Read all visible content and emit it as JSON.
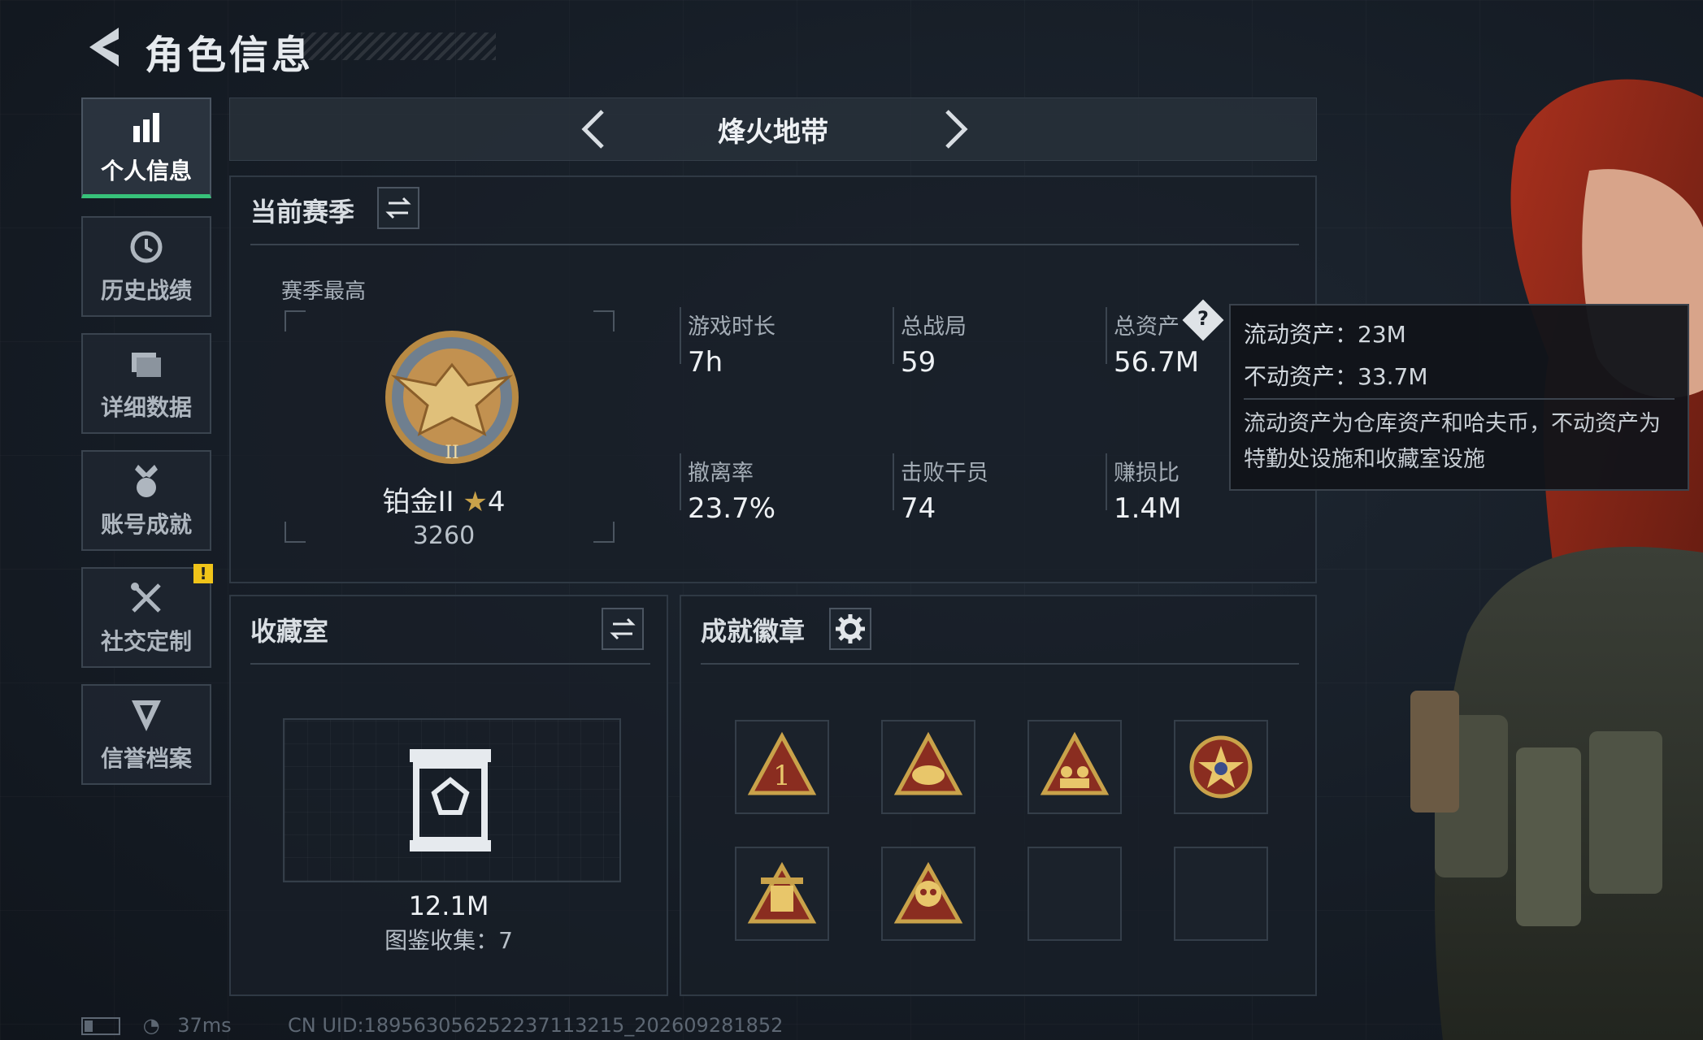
{
  "header": {
    "title": "角色信息"
  },
  "sidebar": {
    "items": [
      {
        "label": "个人信息",
        "icon": "bar-chart-icon",
        "active": true
      },
      {
        "label": "历史战绩",
        "icon": "history-clock-icon"
      },
      {
        "label": "详细数据",
        "icon": "data-cards-icon"
      },
      {
        "label": "账号成就",
        "icon": "achievement-medal-icon"
      },
      {
        "label": "社交定制",
        "icon": "crossed-tools-icon",
        "alert": "!"
      },
      {
        "label": "信誉档案",
        "icon": "reputation-shield-icon"
      }
    ]
  },
  "mode_selector": {
    "title": "烽火地带"
  },
  "season": {
    "title": "当前赛季",
    "best_label": "赛季最高",
    "rank_name": "铂金II",
    "rank_stars": "4",
    "rank_score": "3260",
    "stats": [
      {
        "label": "游戏时长",
        "value": "7h"
      },
      {
        "label": "总战局",
        "value": "59"
      },
      {
        "label": "总资产",
        "value": "56.7M",
        "help": "?"
      },
      {
        "label": "撤离率",
        "value": "23.7%"
      },
      {
        "label": "击败干员",
        "value": "74"
      },
      {
        "label": "赚损比",
        "value": "1.4M"
      }
    ]
  },
  "tooltip": {
    "liquid": "流动资产：23M",
    "fixed": "不动资产：33.7M",
    "description": "流动资产为仓库资产和哈夫币，不动资产为特勤处设施和收藏室设施"
  },
  "collection": {
    "title": "收藏室",
    "value": "12.1M",
    "catalog": "图鉴收集：7"
  },
  "badges": {
    "title": "成就徽章",
    "items": [
      {
        "icon": "rank-one-badge-icon"
      },
      {
        "icon": "helmet-badge-icon"
      },
      {
        "icon": "squad-badge-icon"
      },
      {
        "icon": "star-emblem-badge-icon"
      },
      {
        "icon": "trophy-59-badge-icon"
      },
      {
        "icon": "skull-badge-icon"
      },
      {
        "icon": "empty-slot"
      },
      {
        "icon": "empty-slot"
      }
    ]
  },
  "footer": {
    "ping": "37ms",
    "uid": "CN UID:189563056252237113215_202609281852"
  },
  "colors": {
    "accent_green": "#37c27a",
    "gold": "#c9a24a",
    "warn_yellow": "#f0c419"
  }
}
